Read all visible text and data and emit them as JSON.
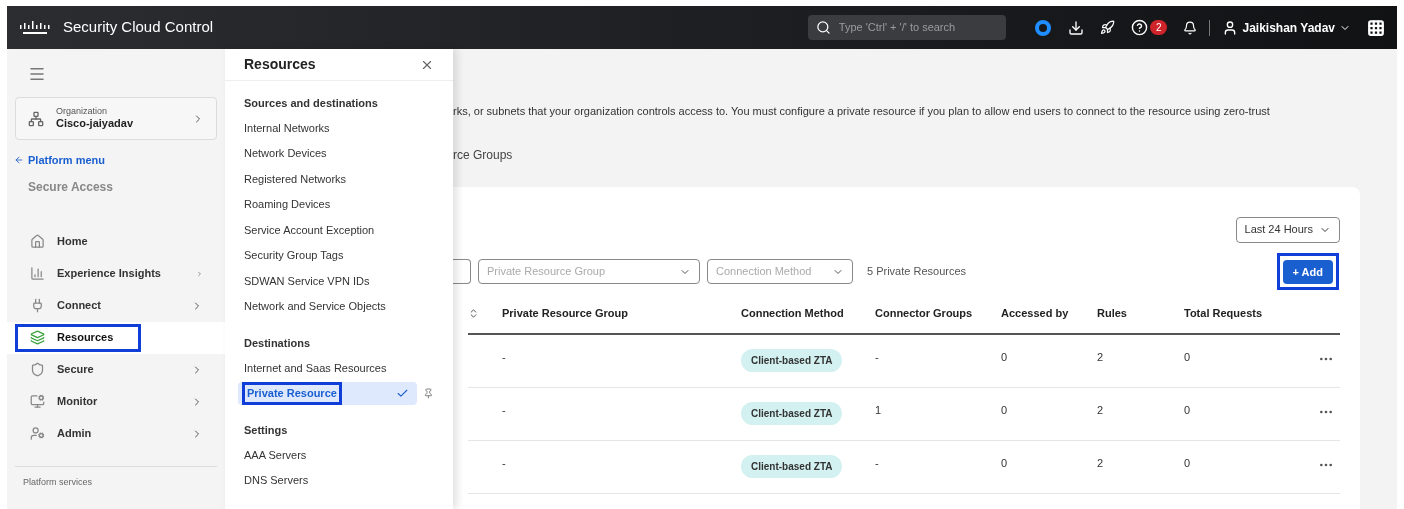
{
  "header": {
    "title": "Security Cloud Control",
    "search": {
      "placeholder": "Type 'Ctrl' + '/' to search"
    },
    "help_badge": "2",
    "user": "Jaikishan Yadav"
  },
  "sidebar": {
    "org_label": "Organization",
    "org_name": "Cisco-jaiyadav",
    "back_link": "Platform menu",
    "section": "Secure Access",
    "items": [
      {
        "label": "Home",
        "has_submenu": false,
        "selected": false,
        "highlighted": false
      },
      {
        "label": "Experience Insights",
        "has_submenu": true,
        "selected": false,
        "highlighted": false
      },
      {
        "label": "Connect",
        "has_submenu": true,
        "selected": false,
        "highlighted": false
      },
      {
        "label": "Resources",
        "has_submenu": false,
        "selected": true,
        "highlighted": true
      },
      {
        "label": "Secure",
        "has_submenu": true,
        "selected": false,
        "highlighted": false
      },
      {
        "label": "Monitor",
        "has_submenu": true,
        "selected": false,
        "highlighted": false
      },
      {
        "label": "Admin",
        "has_submenu": true,
        "selected": false,
        "highlighted": false
      }
    ],
    "footer_section": "Platform services"
  },
  "flyout": {
    "title": "Resources",
    "groups": [
      {
        "title": "Sources and destinations",
        "items": [
          {
            "label": "Internal Networks",
            "selected": false,
            "highlighted": false
          },
          {
            "label": "Network Devices",
            "selected": false,
            "highlighted": false
          },
          {
            "label": "Registered Networks",
            "selected": false,
            "highlighted": false
          },
          {
            "label": "Roaming Devices",
            "selected": false,
            "highlighted": false
          },
          {
            "label": "Service Account Exception",
            "selected": false,
            "highlighted": false
          },
          {
            "label": "Security Group Tags",
            "selected": false,
            "highlighted": false
          },
          {
            "label": "SDWAN Service VPN IDs",
            "selected": false,
            "highlighted": false
          },
          {
            "label": "Network and Service Objects",
            "selected": false,
            "highlighted": false
          }
        ]
      },
      {
        "title": "Destinations",
        "items": [
          {
            "label": "Internet and Saas Resources",
            "selected": false,
            "highlighted": false
          },
          {
            "label": "Private Resource",
            "selected": true,
            "highlighted": true
          }
        ]
      },
      {
        "title": "Settings",
        "items": [
          {
            "label": "AAA Servers",
            "selected": false,
            "highlighted": false
          },
          {
            "label": "DNS Servers",
            "selected": false,
            "highlighted": false
          }
        ]
      }
    ]
  },
  "content": {
    "description": "rks, or subnets that your organization controls access to. You must configure a private resource if you plan to allow end users to connect to the resource using zero-trust",
    "tab": "rce Groups",
    "time_range": "Last 24 Hours",
    "filters": [
      {
        "placeholder": "Private Resource Group"
      },
      {
        "placeholder": "Connection Method"
      }
    ],
    "count": "5 Private Resources",
    "add_button": "+ Add",
    "add_highlighted": true,
    "table": {
      "columns": [
        "Private Resource Group",
        "Connection Method",
        "Connector Groups",
        "Accessed by",
        "Rules",
        "Total Requests"
      ],
      "rows": [
        {
          "group": "-",
          "method": "Client-based ZTA",
          "connector_groups": "-",
          "accessed_by": "0",
          "rules": "2",
          "total_requests": "0"
        },
        {
          "group": "-",
          "method": "Client-based ZTA",
          "connector_groups": "1",
          "accessed_by": "0",
          "rules": "2",
          "total_requests": "0"
        },
        {
          "group": "-",
          "method": "Client-based ZTA",
          "connector_groups": "-",
          "accessed_by": "0",
          "rules": "2",
          "total_requests": "0"
        }
      ]
    }
  }
}
